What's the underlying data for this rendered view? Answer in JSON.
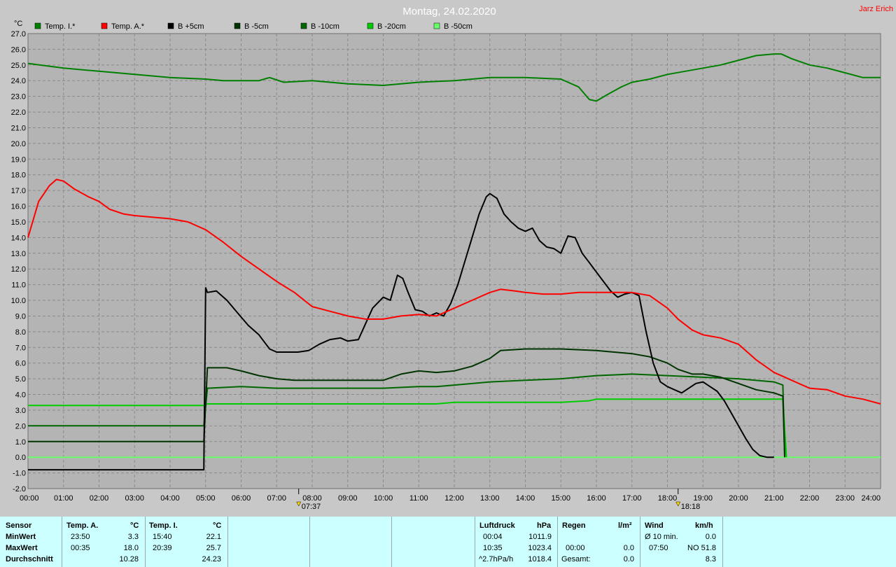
{
  "title": "Montag, 24.02.2020",
  "author": "Jarz Erich",
  "colors": {
    "background": "#c8c8c8",
    "plot": "#b4b4b4",
    "grid": "#8a8a8a",
    "info_panel": "#ccffff"
  },
  "chart_data": {
    "type": "line",
    "ylabel": "°C",
    "xlabel": "",
    "xlim": [
      0,
      24
    ],
    "ylim": [
      -2,
      27
    ],
    "grid": true,
    "legend_position": "top",
    "x_ticks": [
      "00:00",
      "01:00",
      "02:00",
      "03:00",
      "04:00",
      "05:00",
      "06:00",
      "07:00",
      "08:00",
      "09:00",
      "10:00",
      "11:00",
      "12:00",
      "13:00",
      "14:00",
      "15:00",
      "16:00",
      "17:00",
      "18:00",
      "19:00",
      "20:00",
      "21:00",
      "22:00",
      "23:00",
      "24:00"
    ],
    "y_ticks": [
      "-2.0",
      "-1.0",
      "0.0",
      "1.0",
      "2.0",
      "3.0",
      "4.0",
      "5.0",
      "6.0",
      "7.0",
      "8.0",
      "9.0",
      "10.0",
      "11.0",
      "12.0",
      "13.0",
      "14.0",
      "15.0",
      "16.0",
      "17.0",
      "18.0",
      "19.0",
      "20.0",
      "21.0",
      "22.0",
      "23.0",
      "24.0",
      "25.0",
      "26.0",
      "27.0"
    ],
    "annotations": [
      {
        "label": "07:37",
        "x": 7.62,
        "kind": "sunrise"
      },
      {
        "label": "18:18",
        "x": 18.3,
        "kind": "sunset"
      }
    ],
    "series": [
      {
        "name": "Temp. I.*",
        "color": "#008000",
        "x": [
          0,
          1,
          2,
          3,
          4,
          5,
          5.5,
          6,
          6.5,
          6.8,
          7.2,
          8,
          9,
          10,
          11,
          12,
          13,
          14,
          15,
          15.5,
          15.8,
          16,
          16.3,
          16.7,
          17,
          17.5,
          18,
          18.5,
          19,
          19.5,
          20,
          20.5,
          21,
          21.2,
          21.5,
          22,
          22.5,
          23,
          23.5,
          24
        ],
        "y": [
          25.1,
          24.8,
          24.6,
          24.4,
          24.2,
          24.1,
          24.0,
          24.0,
          24.0,
          24.2,
          23.9,
          24.0,
          23.8,
          23.7,
          23.9,
          24.0,
          24.2,
          24.2,
          24.1,
          23.6,
          22.8,
          22.7,
          23.1,
          23.6,
          23.9,
          24.1,
          24.4,
          24.6,
          24.8,
          25.0,
          25.3,
          25.6,
          25.7,
          25.7,
          25.4,
          25.0,
          24.8,
          24.5,
          24.2,
          24.2
        ]
      },
      {
        "name": "Temp. A.*",
        "color": "#ff0000",
        "x": [
          0,
          0.3,
          0.6,
          0.8,
          1,
          1.3,
          1.7,
          2,
          2.3,
          2.7,
          3,
          3.5,
          4,
          4.5,
          5,
          5.5,
          6,
          6.5,
          7,
          7.5,
          8,
          8.5,
          9,
          9.5,
          10,
          10.5,
          11,
          11.5,
          12,
          12.5,
          13,
          13.3,
          13.7,
          14,
          14.5,
          15,
          15.5,
          16,
          16.5,
          17,
          17.5,
          18,
          18.3,
          18.7,
          19,
          19.5,
          20,
          20.5,
          21,
          21.5,
          22,
          22.5,
          23,
          23.5,
          24
        ],
        "y": [
          14.0,
          16.3,
          17.3,
          17.7,
          17.6,
          17.1,
          16.6,
          16.3,
          15.8,
          15.5,
          15.4,
          15.3,
          15.2,
          15.0,
          14.5,
          13.7,
          12.8,
          12.0,
          11.2,
          10.5,
          9.6,
          9.3,
          9.0,
          8.8,
          8.8,
          9.0,
          9.1,
          9.0,
          9.5,
          10.0,
          10.5,
          10.7,
          10.6,
          10.5,
          10.4,
          10.4,
          10.5,
          10.5,
          10.5,
          10.5,
          10.3,
          9.5,
          8.8,
          8.1,
          7.8,
          7.6,
          7.2,
          6.2,
          5.4,
          4.9,
          4.4,
          4.3,
          3.9,
          3.7,
          3.4
        ]
      },
      {
        "name": "B +5cm",
        "color": "#000000",
        "x": [
          0,
          4.95,
          5.0,
          5.05,
          5.3,
          5.6,
          5.9,
          6.2,
          6.5,
          6.8,
          7.0,
          7.3,
          7.6,
          7.9,
          8.2,
          8.5,
          8.8,
          9.0,
          9.3,
          9.5,
          9.7,
          10.0,
          10.2,
          10.4,
          10.55,
          10.7,
          10.9,
          11.1,
          11.3,
          11.5,
          11.7,
          11.9,
          12.1,
          12.3,
          12.5,
          12.7,
          12.9,
          13.0,
          13.2,
          13.4,
          13.6,
          13.8,
          14.0,
          14.2,
          14.4,
          14.6,
          14.8,
          15.0,
          15.2,
          15.4,
          15.6,
          15.8,
          16.0,
          16.2,
          16.4,
          16.6,
          16.8,
          17.0,
          17.2,
          17.4,
          17.6,
          17.8,
          18.0,
          18.2,
          18.4,
          18.6,
          18.8,
          19.0,
          19.2,
          19.4,
          19.6,
          19.8,
          20.0,
          20.2,
          20.4,
          20.6,
          20.8,
          21.0
        ],
        "y": [
          -0.8,
          -0.8,
          10.8,
          10.5,
          10.6,
          10.0,
          9.2,
          8.4,
          7.8,
          6.9,
          6.7,
          6.7,
          6.7,
          6.8,
          7.2,
          7.5,
          7.6,
          7.4,
          7.5,
          8.5,
          9.5,
          10.2,
          10.0,
          11.6,
          11.4,
          10.5,
          9.4,
          9.3,
          9.0,
          9.2,
          9.0,
          9.8,
          11.0,
          12.5,
          14.0,
          15.5,
          16.6,
          16.8,
          16.5,
          15.5,
          15.0,
          14.6,
          14.4,
          14.6,
          13.8,
          13.4,
          13.3,
          13.0,
          14.1,
          14.0,
          13.0,
          12.4,
          11.8,
          11.2,
          10.6,
          10.2,
          10.4,
          10.5,
          10.3,
          8.0,
          6.0,
          4.8,
          4.5,
          4.3,
          4.1,
          4.4,
          4.7,
          4.8,
          4.5,
          4.2,
          3.6,
          2.8,
          2.0,
          1.2,
          0.5,
          0.1,
          0.0,
          0.0
        ]
      },
      {
        "name": "B -5cm",
        "color": "#003300",
        "x": [
          0,
          4.95,
          5.05,
          5.6,
          6.0,
          6.5,
          7.0,
          7.5,
          8.0,
          9.0,
          10.0,
          10.5,
          11.0,
          11.5,
          12.0,
          12.5,
          13.0,
          13.3,
          14.0,
          15.0,
          16.0,
          16.5,
          17.0,
          17.5,
          18.0,
          18.3,
          18.7,
          19.0,
          19.5,
          20.0,
          20.5,
          21.0,
          21.25,
          21.3
        ],
        "y": [
          1.0,
          1.0,
          5.7,
          5.7,
          5.5,
          5.2,
          5.0,
          4.9,
          4.9,
          4.9,
          4.9,
          5.3,
          5.5,
          5.4,
          5.5,
          5.8,
          6.3,
          6.8,
          6.9,
          6.9,
          6.8,
          6.7,
          6.6,
          6.4,
          6.0,
          5.6,
          5.3,
          5.3,
          5.1,
          4.7,
          4.3,
          4.1,
          3.9,
          0.0
        ]
      },
      {
        "name": "B -10cm",
        "color": "#006600",
        "x": [
          0,
          4.95,
          5.05,
          6.0,
          7.0,
          8.0,
          9.0,
          10.0,
          11.0,
          11.5,
          12.0,
          13.0,
          14.0,
          15.0,
          15.5,
          16.0,
          17.0,
          18.0,
          19.0,
          20.0,
          21.0,
          21.25,
          21.3
        ],
        "y": [
          2.0,
          2.0,
          4.4,
          4.5,
          4.4,
          4.4,
          4.4,
          4.4,
          4.5,
          4.5,
          4.6,
          4.8,
          4.9,
          5.0,
          5.1,
          5.2,
          5.3,
          5.2,
          5.1,
          5.0,
          4.8,
          4.6,
          0.0
        ]
      },
      {
        "name": "B -20cm",
        "color": "#00cc00",
        "x": [
          0,
          4.95,
          5.05,
          6.0,
          8.0,
          10.0,
          11.5,
          12.0,
          14.0,
          15.0,
          15.8,
          16.0,
          17.0,
          18.0,
          20.0,
          21.0,
          21.25,
          21.35
        ],
        "y": [
          3.3,
          3.3,
          3.4,
          3.4,
          3.4,
          3.4,
          3.4,
          3.5,
          3.5,
          3.5,
          3.6,
          3.7,
          3.7,
          3.7,
          3.7,
          3.7,
          3.7,
          0.0
        ]
      },
      {
        "name": "B -50cm",
        "color": "#66ff66",
        "x": [
          0,
          24
        ],
        "y": [
          0.0,
          0.0
        ]
      }
    ]
  },
  "info": {
    "sensor_header": "Sensor",
    "row_labels": [
      "MinWert",
      "MaxWert",
      "Durchschnitt"
    ],
    "temp_a": {
      "header": "Temp. A.",
      "unit": "°C",
      "times": [
        "23:50",
        "00:35",
        ""
      ],
      "values": [
        "3.3",
        "18.0",
        "10.28"
      ]
    },
    "temp_i": {
      "header": "Temp. I.",
      "unit": "°C",
      "times": [
        "15:40",
        "20:39",
        ""
      ],
      "values": [
        "22.1",
        "25.7",
        "24.23"
      ]
    },
    "pressure": {
      "header": "Luftdruck",
      "unit": "hPa",
      "labels": [
        "00:04",
        "10:35",
        "^2.7hPa/h"
      ],
      "values": [
        "1011.9",
        "1023.4",
        "1018.4"
      ]
    },
    "rain": {
      "header": "Regen",
      "unit": "l/m²",
      "labels": [
        "",
        "00:00",
        "Gesamt:"
      ],
      "values": [
        "",
        "0.0",
        "0.0"
      ]
    },
    "wind": {
      "header": "Wind",
      "unit": "km/h",
      "labels": [
        "Ø 10 min.",
        "07:50",
        ""
      ],
      "values": [
        "0.0",
        "NO 51.8",
        "8.3"
      ]
    }
  }
}
